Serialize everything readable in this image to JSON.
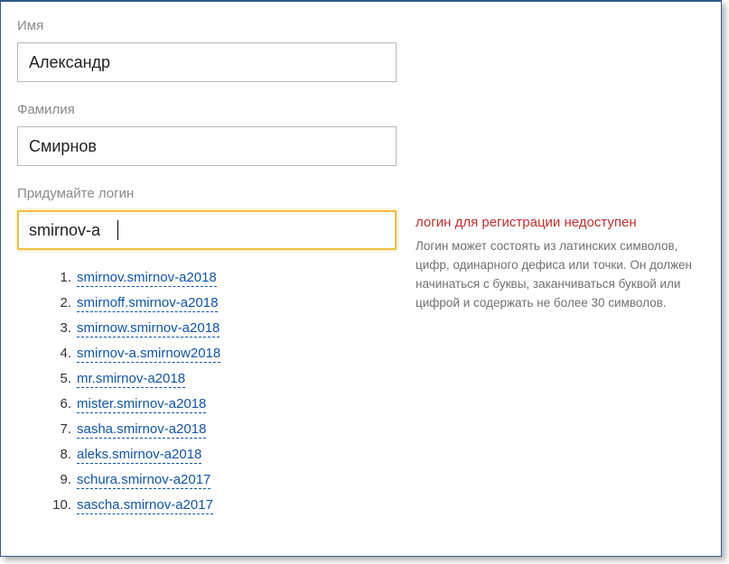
{
  "form": {
    "firstName": {
      "label": "Имя",
      "value": "Александр"
    },
    "lastName": {
      "label": "Фамилия",
      "value": "Смирнов"
    },
    "login": {
      "label": "Придумайте логин",
      "value": "smirnov-a"
    }
  },
  "validation": {
    "errorTitle": "логин для регистрации недоступен",
    "errorText": "Логин может состоять из латинских символов, цифр, одинарного дефиса или точки. Он должен начинаться с буквы, заканчиваться буквой или цифрой и содержать не более 30 символов."
  },
  "suggestions": [
    "smirnov.smirnov-a2018",
    "smirnoff.smirnov-a2018",
    "smirnow.smirnov-a2018",
    "smirnov-a.smirnow2018",
    "mr.smirnov-a2018",
    "mister.smirnov-a2018",
    "sasha.smirnov-a2018",
    "aleks.smirnov-a2018",
    "schura.smirnov-a2017",
    "sascha.smirnov-a2017"
  ]
}
